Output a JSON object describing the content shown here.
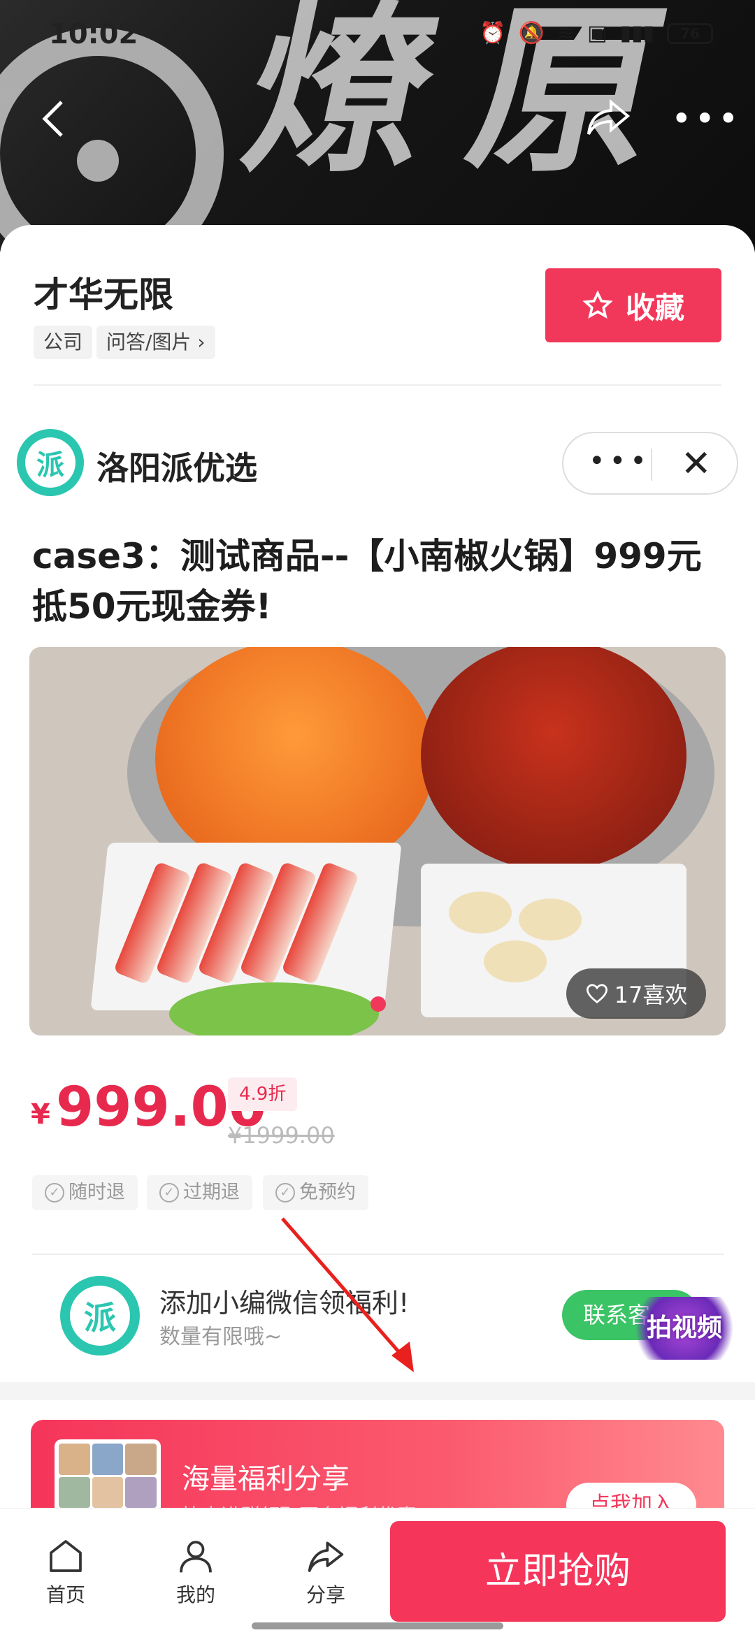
{
  "status_bar": {
    "time": "10:02",
    "battery": "76"
  },
  "hero": {
    "brush_text": "燎原"
  },
  "company": {
    "title": "才华无限",
    "tags": [
      "公司",
      "问答/图片 ›"
    ],
    "favorite_label": "收藏"
  },
  "merchant": {
    "logo_char": "派",
    "name": "洛阳派优选",
    "more_label": "•••",
    "close_label": "✕"
  },
  "product": {
    "title": "case3：测试商品--【小南椒火锅】999元抵50元现金券!",
    "likes_label": "17喜欢",
    "price_symbol": "¥",
    "price": "999.00",
    "discount": "4.9折",
    "original_price": "¥1999.00",
    "services": [
      "随时退",
      "过期退",
      "免预约"
    ]
  },
  "wechat": {
    "logo_char": "派",
    "title": "添加小编微信领福利!",
    "subtitle": "数量有限哦~",
    "contact_label": "联系客",
    "video_badge": "拍视频"
  },
  "banner": {
    "title": "海量福利分享",
    "subtitle": "快来进群领取更多福利优惠!",
    "join_label": "点我加入"
  },
  "bottom_nav": {
    "home": "首页",
    "mine": "我的",
    "share": "分享",
    "buy": "立即抢购"
  },
  "colors": {
    "accent": "#f2385a",
    "price": "#e8294e",
    "teal": "#2ac6b0",
    "green": "#3ac465"
  }
}
